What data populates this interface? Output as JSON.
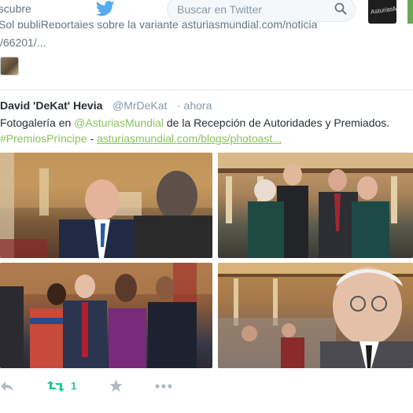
{
  "nav": {
    "descubre": "escubre",
    "search_placeholder": "Buscar en Twitter",
    "account_label": "AsturiasMu"
  },
  "previous_tweet": {
    "line1": "Sol publiReportajes sobre la variante asturiasmundial.com/noticia",
    "line2": "/66201/..."
  },
  "tweet": {
    "author": "David 'DeKat' Hevia",
    "handle": "@MrDeKat",
    "time": "· ahora",
    "text_1": "Fotogalería en ",
    "mention": "@AsturiasMundial",
    "text_2": " de la Recepción de Autoridades y Premiados.",
    "hashtag": "#PremiosPríncipe",
    "sep": " - ",
    "url": "asturiasmundial.com/blogs/photoast..."
  },
  "actions": {
    "retweet_count": "1"
  },
  "colors": {
    "link": "#89c35c",
    "retweet": "#19cf86",
    "twitter_blue": "#55acee"
  }
}
